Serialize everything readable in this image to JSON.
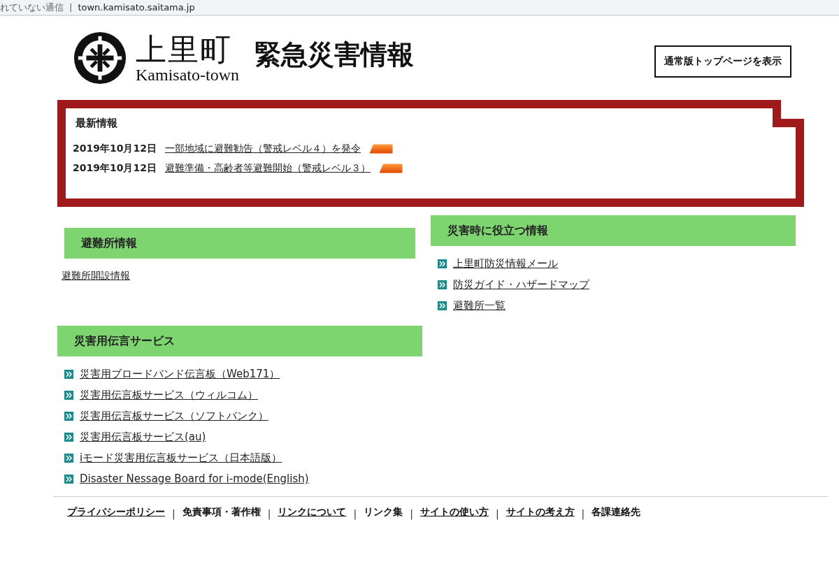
{
  "address_bar": {
    "security": "れていない通信",
    "separator": "|",
    "url": "town.kamisato.saitama.jp"
  },
  "header": {
    "logo_name": "上里町",
    "logo_subtitle": "Kamisato-town",
    "title": "緊急災害情報",
    "top_button": "通常版トップページを表示"
  },
  "news": {
    "heading": "最新情報",
    "items": [
      {
        "date": "2019年10月12日",
        "title": "一部地域に避難勧告（警戒レベル４）を発令",
        "new": true
      },
      {
        "date": "2019年10月12日",
        "title": "避難準備・高齢者等避難開始（警戒レベル３）",
        "new": true
      }
    ]
  },
  "shelter": {
    "heading": "避難所情報",
    "links": [
      "避難所開設情報"
    ]
  },
  "useful": {
    "heading": "災害時に役立つ情報",
    "links": [
      "上里町防災情報メール",
      "防災ガイド・ハザードマップ",
      "避難所一覧"
    ]
  },
  "message": {
    "heading": "災害用伝言サービス",
    "links": [
      "災害用ブロードバンド伝言板（Web171）",
      "災害用伝言板サービス（ウィルコム）",
      "災害用伝言板サービス（ソフトバンク）",
      "災害用伝言板サービス(au)",
      "iモード災害用伝言板サービス（日本語版）",
      "Disaster Nessage Board for i-mode(English)"
    ]
  },
  "footer_links": [
    {
      "label": "プライバシーポリシー",
      "underlined": true
    },
    {
      "label": "免責事項・著作権",
      "underlined": false,
      "separator": "|"
    },
    {
      "label": "リンクについて",
      "underlined": true,
      "separator": "|"
    },
    {
      "label": "リンク集",
      "underlined": false,
      "separator": "|"
    },
    {
      "label": "サイトの使い方",
      "underlined": true,
      "separator": "|"
    },
    {
      "label": "サイトの考え方",
      "underlined": true,
      "separator": "|"
    },
    {
      "label": "各課連絡先",
      "underlined": false,
      "separator": "|"
    }
  ]
}
